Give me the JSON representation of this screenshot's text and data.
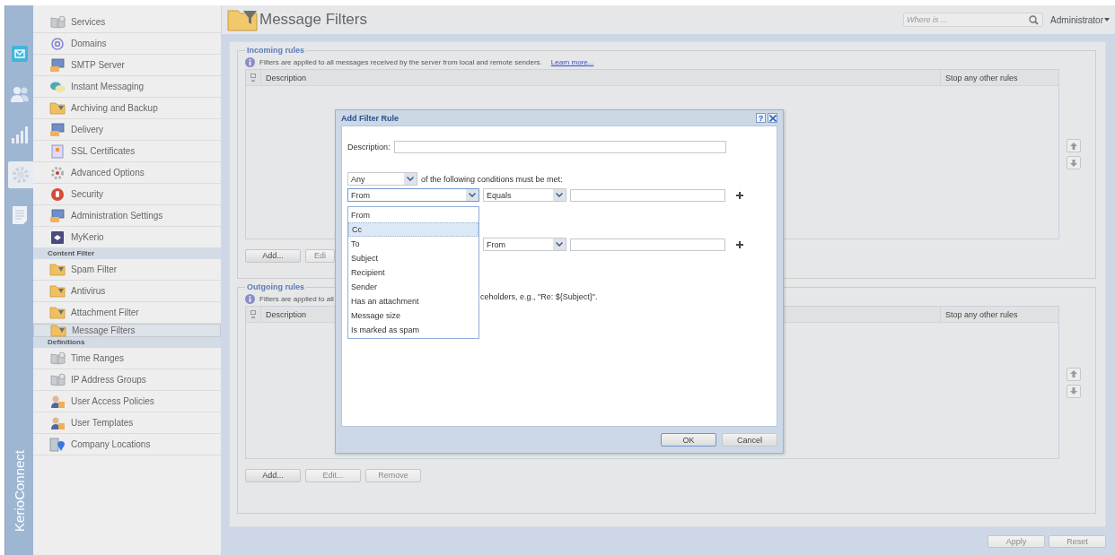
{
  "product": "KerioConnect",
  "rail": [
    {
      "selected": false
    },
    {
      "selected": false
    },
    {
      "selected": false
    },
    {
      "selected": true
    },
    {
      "selected": false
    }
  ],
  "sidebar": {
    "sections": [
      {
        "items": [
          {
            "label": "Services",
            "selected": false
          },
          {
            "label": "Domains",
            "selected": false
          },
          {
            "label": "SMTP Server",
            "selected": false
          },
          {
            "label": "Instant Messaging",
            "selected": false
          },
          {
            "label": "Archiving and Backup",
            "selected": false
          },
          {
            "label": "Delivery",
            "selected": false
          },
          {
            "label": "SSL Certificates",
            "selected": false
          },
          {
            "label": "Advanced Options",
            "selected": false
          },
          {
            "label": "Security",
            "selected": false
          },
          {
            "label": "Administration Settings",
            "selected": false
          },
          {
            "label": "MyKerio",
            "selected": false
          }
        ]
      },
      {
        "title": "Content Filter",
        "items": [
          {
            "label": "Spam Filter",
            "selected": false
          },
          {
            "label": "Antivirus",
            "selected": false
          },
          {
            "label": "Attachment Filter",
            "selected": false
          },
          {
            "label": "Message Filters",
            "selected": true
          }
        ]
      },
      {
        "title": "Definitions",
        "items": [
          {
            "label": "Time Ranges",
            "selected": false
          },
          {
            "label": "IP Address Groups",
            "selected": false
          },
          {
            "label": "User Access Policies",
            "selected": false
          },
          {
            "label": "User Templates",
            "selected": false
          },
          {
            "label": "Company Locations",
            "selected": false
          }
        ]
      }
    ]
  },
  "header": {
    "title": "Message Filters",
    "search": {
      "placeholder": "Where is ..."
    },
    "user": "Administrator"
  },
  "incoming": {
    "legend": "Incoming rules",
    "info": "Filters are applied to all messages received by the server from local and remote senders.",
    "link": "Learn more...",
    "columns": [
      "Description",
      "Stop any other rules"
    ],
    "buttons": [
      {
        "label": "Add...",
        "disabled": false
      },
      {
        "label": "Edi",
        "disabled": true
      }
    ]
  },
  "outgoing": {
    "legend": "Outgoing rules",
    "info": "Filters are applied to all",
    "columns": [
      "Description",
      "Stop any other rules"
    ],
    "buttons": [
      {
        "label": "Add...",
        "disabled": false
      },
      {
        "label": "Edit...",
        "disabled": true
      },
      {
        "label": "Remove",
        "disabled": true
      }
    ]
  },
  "footer_buttons": [
    {
      "label": "Apply",
      "disabled": true
    },
    {
      "label": "Reset",
      "disabled": true
    }
  ],
  "dialog": {
    "title": "Add Filter Rule",
    "help": "?",
    "description_label": "Description:",
    "match": {
      "value": "Any",
      "text": "of the following conditions must be met:"
    },
    "condition": {
      "field": "From",
      "operator": "Equals"
    },
    "action": {
      "value": "From"
    },
    "dropdown": [
      {
        "label": "From",
        "selected": false
      },
      {
        "label": "Cc",
        "selected": true
      },
      {
        "label": "To",
        "selected": false
      },
      {
        "label": "Subject",
        "selected": false
      },
      {
        "label": "Recipient",
        "selected": false
      },
      {
        "label": "Sender",
        "selected": false
      },
      {
        "label": "Has an attachment",
        "selected": false
      },
      {
        "label": "Message size",
        "selected": false
      },
      {
        "label": "Is marked as spam",
        "selected": false
      }
    ],
    "hint": "ceholders, e.g., \"Re: ${Subject}\".",
    "buttons": [
      "OK",
      "Cancel"
    ]
  }
}
